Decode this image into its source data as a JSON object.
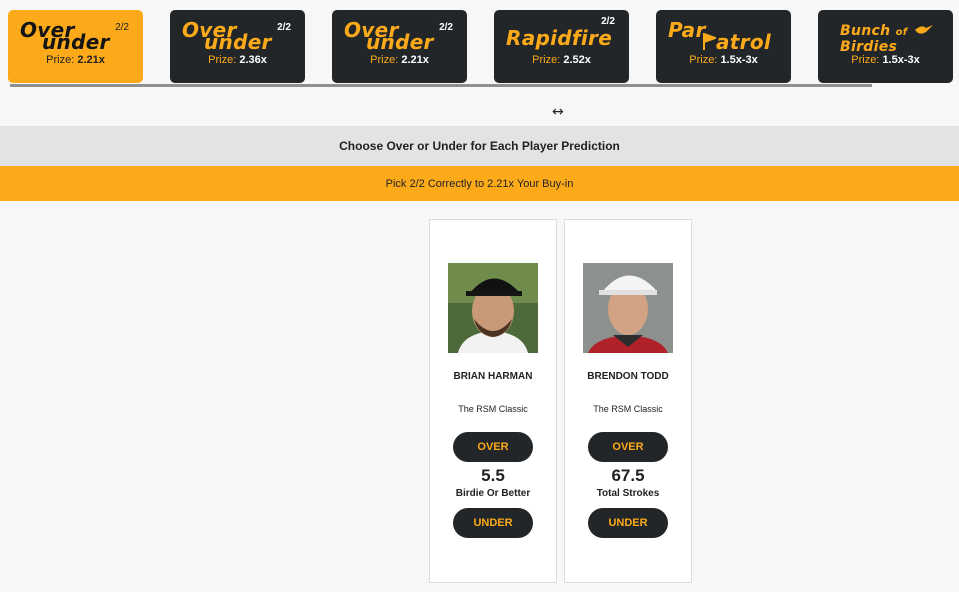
{
  "tabs": [
    {
      "logo_line1": "Over",
      "logo_line2": "under",
      "count": "2/2",
      "prize_label": "Prize:",
      "prize_value": "2.21x"
    },
    {
      "logo_line1": "Over",
      "logo_line2": "under",
      "count": "2/2",
      "prize_label": "Prize:",
      "prize_value": "2.36x"
    },
    {
      "logo_line1": "Over",
      "logo_line2": "under",
      "count": "2/2",
      "prize_label": "Prize:",
      "prize_value": "2.21x"
    },
    {
      "logo_line1": "Rapidfire",
      "count": "2/2",
      "prize_label": "Prize:",
      "prize_value": "2.52x"
    },
    {
      "logo_line1": "Par",
      "logo_line2": "atrol",
      "prize_label": "Prize:",
      "prize_value": "1.5x-3x"
    },
    {
      "logo_line1": "Bunch",
      "logo_line1b": "of",
      "logo_line2": "Birdies",
      "prize_label": "Prize:",
      "prize_value": "1.5x-3x"
    }
  ],
  "resize_icon": "↔",
  "header": {
    "title": "Choose Over or Under for Each Player Prediction"
  },
  "rule": {
    "text": "Pick 2/2 Correctly to 2.21x Your Buy-in"
  },
  "players": [
    {
      "name": "BRIAN HARMAN",
      "event": "The RSM Classic",
      "over_label": "OVER",
      "line": "5.5",
      "stat": "Birdie Or Better",
      "under_label": "UNDER"
    },
    {
      "name": "BRENDON TODD",
      "event": "The RSM Classic",
      "over_label": "OVER",
      "line": "67.5",
      "stat": "Total Strokes",
      "under_label": "UNDER"
    }
  ],
  "colors": {
    "accent": "#fdaa1a",
    "dark": "#232629"
  }
}
